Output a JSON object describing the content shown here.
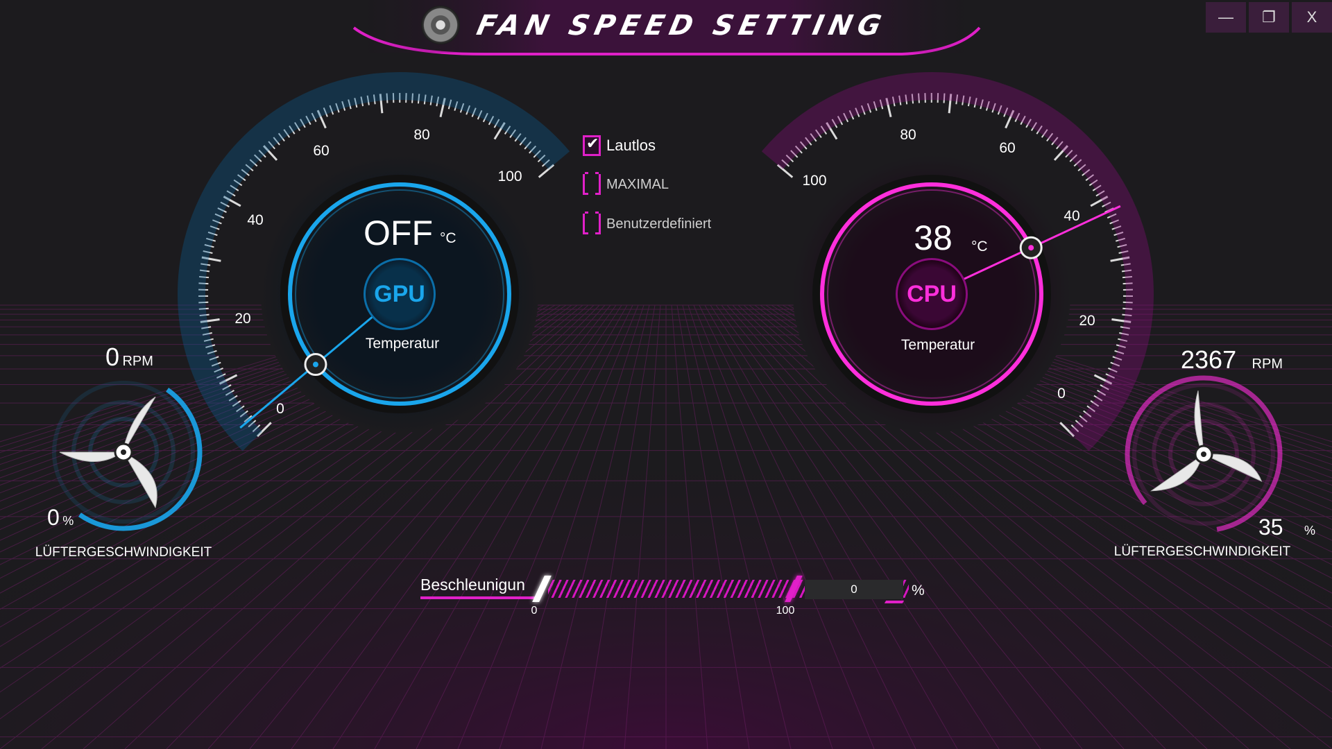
{
  "app": {
    "title": "FAN SPEED SETTING",
    "icon": "fan-app-icon"
  },
  "window_controls": {
    "minimize": "—",
    "restore": "❐",
    "close": "X"
  },
  "colors": {
    "gpu_accent": "#1aa6ec",
    "cpu_accent": "#ff2fdc",
    "background": "#1c1b1e",
    "checkbox_accent": "#e020c8"
  },
  "gpu": {
    "chip_label": "GPU",
    "temperature_value": "OFF",
    "temperature_unit": "°C",
    "temperature_caption": "Temperatur",
    "gauge_ticks": [
      "0",
      "20",
      "40",
      "60",
      "80",
      "100"
    ],
    "fan_rpm": "0",
    "rpm_unit": "RPM",
    "fan_percent": "0",
    "percent_unit": "%",
    "fan_percent_level": 0.0,
    "fan_caption": "LÜFTERGESCHWINDIGKEIT"
  },
  "cpu": {
    "chip_label": "CPU",
    "temperature_value": "38",
    "temperature_unit": "°C",
    "temperature_caption": "Temperatur",
    "gauge_ticks": [
      "0",
      "20",
      "40",
      "60",
      "80",
      "100"
    ],
    "fan_rpm": "2367",
    "rpm_unit": "RPM",
    "fan_percent": "35",
    "percent_unit": "%",
    "fan_percent_level": 0.35,
    "fan_caption": "LÜFTERGESCHWINDIGKEIT"
  },
  "modes": [
    {
      "label": "Lautlos",
      "checked": true
    },
    {
      "label": "MAXIMAL",
      "checked": false
    },
    {
      "label": "Benutzerdefiniert",
      "checked": false
    }
  ],
  "acceleration": {
    "label": "Beschleunigun",
    "min_label": "0",
    "max_label": "100",
    "value": "0",
    "unit": "%"
  }
}
